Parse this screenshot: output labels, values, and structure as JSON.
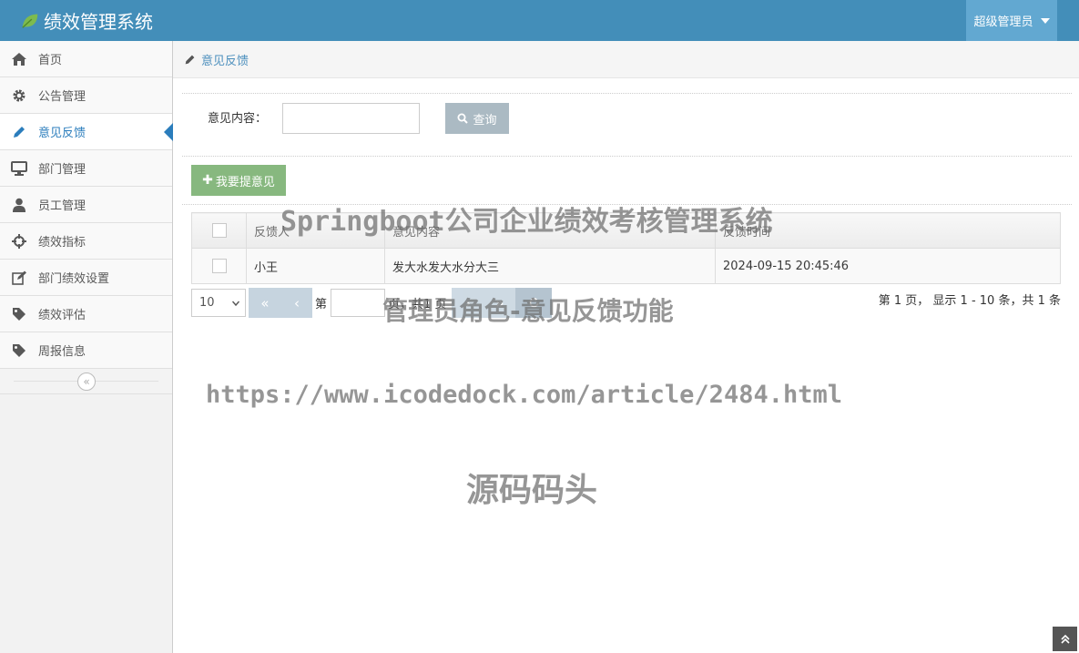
{
  "app": {
    "title": "绩效管理系统",
    "user": "超级管理员"
  },
  "sidebar": {
    "items": [
      {
        "label": "首页",
        "icon": "home-icon"
      },
      {
        "label": "公告管理",
        "icon": "gear-icon"
      },
      {
        "label": "意见反馈",
        "icon": "pencil-icon",
        "active": true
      },
      {
        "label": "部门管理",
        "icon": "desktop-icon"
      },
      {
        "label": "员工管理",
        "icon": "user-icon"
      },
      {
        "label": "绩效指标",
        "icon": "crosshair-icon"
      },
      {
        "label": "部门绩效设置",
        "icon": "edit-icon"
      },
      {
        "label": "绩效评估",
        "icon": "tag-icon"
      },
      {
        "label": "周报信息",
        "icon": "tag-icon"
      }
    ],
    "collapse_glyph": "«"
  },
  "breadcrumb": {
    "label": "意见反馈"
  },
  "search": {
    "label": "意见内容：",
    "value": "",
    "button": "查询"
  },
  "add_button": "我要提意见",
  "table": {
    "headers": [
      "反馈人",
      "意见内容",
      "反馈时间"
    ],
    "rows": [
      {
        "user": "小王",
        "content": "发大水发大水分大三",
        "time": "2024-09-15 20:45:46"
      }
    ]
  },
  "pager": {
    "page_size": "10",
    "first": "«",
    "prev": "‹",
    "label_prefix": "第",
    "label_suffix": "页，共1 页",
    "summary": "第 1 页， 显示 1 - 10 条，共 1 条"
  },
  "watermarks": {
    "title": "Springboot公司企业绩效考核管理系统",
    "subtitle": "管理员角色-意见反馈功能",
    "url": "https://www.icodedock.com/article/2484.html",
    "brand": "源码码头"
  },
  "colors": {
    "topbar": "#438eb9",
    "active": "#2b7dbc",
    "add": "#87b87f",
    "query": "#abbac3"
  }
}
